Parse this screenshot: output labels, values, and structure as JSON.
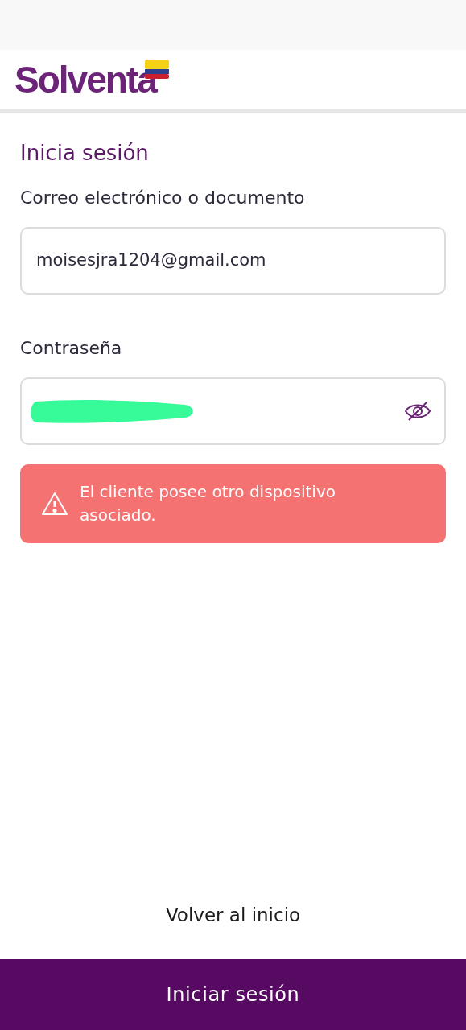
{
  "header": {
    "logo": "Solventa"
  },
  "title": "Inicia sesión",
  "email": {
    "label": "Correo electrónico o documento",
    "value": "moisesjra1204@gmail.com"
  },
  "password": {
    "label": "Contraseña",
    "redacted": true,
    "visible": false
  },
  "alert": {
    "kind": "error",
    "message": "El cliente posee otro dispositivo asociado."
  },
  "back_link": "Volver al inicio",
  "submit": "Iniciar sesión"
}
